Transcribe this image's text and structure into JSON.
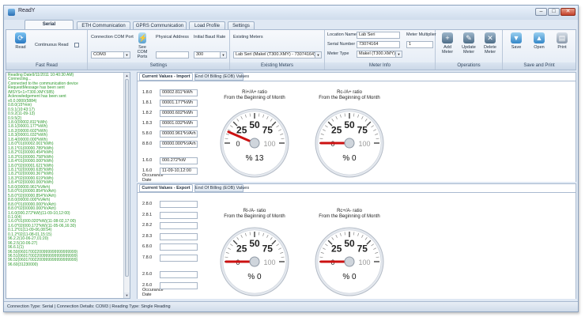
{
  "window": {
    "title": "ReadY"
  },
  "tabs": [
    "Serial Communication",
    "ETH Communication",
    "GPRS Communication",
    "Load Profile",
    "Settings"
  ],
  "ribbon": {
    "fast_read": {
      "read_label": "Read",
      "continuous_read_label": "Continuous Read",
      "group_label": "Fast Read"
    },
    "settings": {
      "com_port_label": "Connection COM Port",
      "com_port_value": "COM3",
      "see_ports_label": "See COM Ports",
      "physical_address_label": "Physical Address",
      "physical_address_value": "",
      "baud_label": "Initial Baud Rate",
      "baud_value": "300",
      "group_label": "Settings"
    },
    "existing_meters": {
      "label": "Existing Meters",
      "value": "Lab Seri (Makel (T300.XMY) - 73074164) ...",
      "group_label": "Existing Meters"
    },
    "meter_info": {
      "location_label": "Location Name",
      "location_value": "Lab Seri",
      "serial_label": "Serial Number",
      "serial_value": "73074164",
      "type_label": "Meter Type",
      "type_value": "Makel (T300.XMY)",
      "multiplier_label": "Meter Multiplier",
      "multiplier_value": "1",
      "group_label": "Meter Info"
    },
    "operations": {
      "add": "Add Meter",
      "update": "Update Meter",
      "delete": "Delete Meter",
      "group_label": "Operations"
    },
    "save_print": {
      "save": "Save",
      "open": "Open",
      "print": "Print",
      "group_label": "Save and Print"
    }
  },
  "log": [
    "Reading Date9/11/2011 10:40:30 AM)",
    "Connecting...",
    "Connected to the communication device",
    "RequestMessage has been sent",
    "/MSYS<1>T300.XMY.585)",
    "Acknowledgement has been sent",
    "v0.0.0000(5884)",
    "0.8.0(15*min)",
    "0.9.1(10:43:17)",
    "0.9.2(11-09-13)",
    "0.9.5(2)",
    "1.8.0(00002.811*kWh)",
    "1.8.1(00001.177*kWh)",
    "1.8.2(00000.602*kWh)",
    "1.8.3(00001.032*kWh)",
    "1.8.4(00000.000*kWh)",
    "1.8.0*01(00002.001*kWh)",
    "1.8.1*01(00000.789*kWh)",
    "1.8.2*01(00000.454*kWh)",
    "1.8.3*01(00000.758*kWh)",
    "1.8.4*01(00000.000*kWh)",
    "1.8.0*02(00001.621*kWh)",
    "1.8.1*02(00000.635*kWh)",
    "1.8.2*02(00000.367*kWh)",
    "1.8.3*02(00000.619*kWh)",
    "1.8.4*02(00000.000*kWh)",
    "5.8.0(00000.961*kVArh)",
    "5.8.0*01(00000.854*kVArh)",
    "5.8.0*02(00000.854*kVArh)",
    "8.8.0(00000.000*kVArh)",
    "8.8.0*01(00000.000*kVArh)",
    "8.8.0*02(00000.000*kVArh)",
    "1.6.0(000.272*kW)(11-09-10,12:00)",
    "0.1.0(4)",
    "1.6.0*01(000.020*kW)(11-08-02,17:00)",
    "1.6.0*02(000.172*kW)(11-05-06,16:30)",
    "0.1.2*01(11-09-06,08:54)",
    "0.1.2*02(11-08-01,15:15)",
    "96.2.2(10-06-27,01:20)",
    "96.2.5(10-06-27)",
    "96.6.1(1)",
    "96.50(06017002200999999999999999)",
    "96.51(06017002200999999999999999)",
    "96.52(06017002200999999999999999)",
    "96.60(31230000)"
  ],
  "import_panel": {
    "tabs": [
      "Current Values - Import",
      "End Of Billing (EOB) Values"
    ],
    "rows": [
      {
        "code": "1.8.0",
        "value": "00002.811*kWh"
      },
      {
        "code": "1.8.1",
        "value": "00001.177*kWh"
      },
      {
        "code": "1.8.2",
        "value": "00000.602*kWh"
      },
      {
        "code": "1.8.3",
        "value": "00001.032*kWh"
      },
      {
        "code": "5.8.0",
        "value": "00000.961*kVArh"
      },
      {
        "code": "8.8.0",
        "value": "00000.000*kVArh"
      },
      {
        "code": "1.6.0",
        "value": "000.272*kW"
      },
      {
        "code": "1.6.0 Occurance Date",
        "value": "11-09-10,12:00"
      }
    ],
    "gauges": [
      {
        "title": "Ri+/A+ ratio\nFrom the Beginning of Month",
        "percent_label": "% 13",
        "value": 13,
        "scale": [
          "0",
          "25",
          "50",
          "75",
          "100"
        ]
      },
      {
        "title": "Rc-/A+ ratio\nFrom the Beginning of Month",
        "percent_label": "% 0",
        "value": 0,
        "scale": [
          "0",
          "25",
          "50",
          "75",
          "100"
        ]
      }
    ]
  },
  "export_panel": {
    "tabs": [
      "Current Values - Export",
      "End Of Billing (EOB) Values"
    ],
    "rows": [
      {
        "code": "2.8.0",
        "value": ""
      },
      {
        "code": "2.8.1",
        "value": ""
      },
      {
        "code": "2.8.2",
        "value": ""
      },
      {
        "code": "2.8.3",
        "value": ""
      },
      {
        "code": "6.8.0",
        "value": ""
      },
      {
        "code": "7.8.0",
        "value": ""
      },
      {
        "code": "2.6.0",
        "value": ""
      },
      {
        "code": "2.6.0 Occurance Date",
        "value": ""
      }
    ],
    "gauges": [
      {
        "title": "Ri-/A- ratio\nFrom the Beginning of Month",
        "percent_label": "% 0",
        "value": 0,
        "scale": [
          "0",
          "25",
          "50",
          "75",
          "100"
        ]
      },
      {
        "title": "Rc+/A- ratio\nFrom the Beginning of Month",
        "percent_label": "% 0",
        "value": 0,
        "scale": [
          "0",
          "25",
          "50",
          "75",
          "100"
        ]
      }
    ]
  },
  "status_bar": "Connection Type: Serial | Connection Details: COM3 | Reading Type: Single Reading",
  "colors": {
    "log_text": "#2e9a2e",
    "needle": "#cc1111",
    "accent": "#2a6fb3"
  }
}
